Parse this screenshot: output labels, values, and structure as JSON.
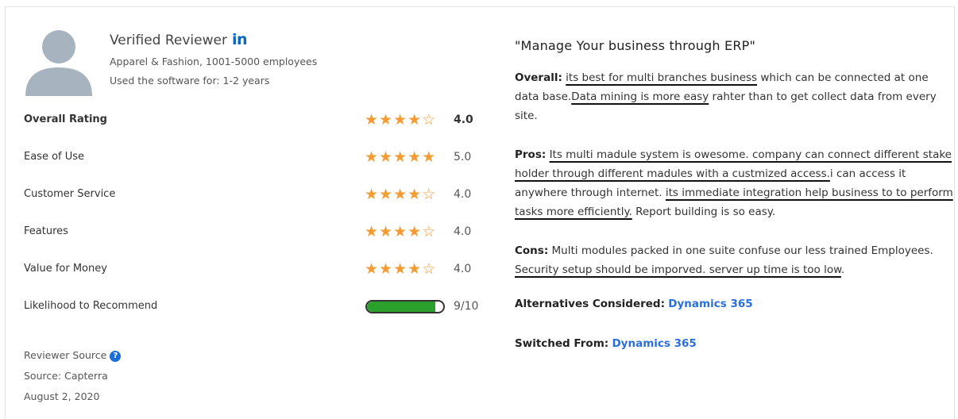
{
  "reviewer": {
    "name": "Verified Reviewer",
    "linkedin_badge": "in",
    "industry": "Apparel & Fashion, 1001-5000 employees",
    "usage": "Used the software for: 1-2 years"
  },
  "ratings": [
    {
      "label": "Overall Rating",
      "stars": 4,
      "score": "4.0"
    },
    {
      "label": "Ease of Use",
      "stars": 5,
      "score": "5.0"
    },
    {
      "label": "Customer Service",
      "stars": 4,
      "score": "4.0"
    },
    {
      "label": "Features",
      "stars": 4,
      "score": "4.0"
    },
    {
      "label": "Value for Money",
      "stars": 4,
      "score": "4.0"
    }
  ],
  "recommend": {
    "label": "Likelihood to Recommend",
    "value": 9,
    "max": 10,
    "text": "9/10"
  },
  "source": {
    "title": "Reviewer Source",
    "source_text": "Source: Capterra",
    "date": "August 2, 2020"
  },
  "review": {
    "title": "\"Manage Your business through ERP\"",
    "overall_label": "Overall:",
    "overall_parts": [
      {
        "text": "its best for multi branches business",
        "ul": true
      },
      {
        "text": " which can be connected at one data base.",
        "ul": false
      },
      {
        "text": "Data mining is more easy",
        "ul": true
      },
      {
        "text": " rahter than to get collect data from every site.",
        "ul": false
      }
    ],
    "pros_label": "Pros:",
    "pros_parts": [
      {
        "text": "Its multi madule system is owesome. company can connect different stake holder through different madules with a custmized access.",
        "ul": true
      },
      {
        "text": "i can access it anywhere through internet. ",
        "ul": false
      },
      {
        "text": "its immediate integration help business to to perform tasks more efficiently.",
        "ul": true
      },
      {
        "text": " Report building is so easy.",
        "ul": false
      }
    ],
    "cons_label": "Cons:",
    "cons_parts": [
      {
        "text": "Multi modules packed in one suite confuse our less trained Employees. ",
        "ul": false
      },
      {
        "text": "Security setup should be imporved. server up time is too low",
        "ul": true
      },
      {
        "text": ".",
        "ul": false
      }
    ],
    "alternatives_label": "Alternatives Considered:",
    "alternatives_value": "Dynamics 365",
    "switched_label": "Switched From:",
    "switched_value": "Dynamics 365"
  },
  "colors": {
    "star": "#f29c38",
    "link": "#2a6fdb",
    "linkedin": "#0a66c2",
    "bar_fill": "#2ca02c"
  }
}
